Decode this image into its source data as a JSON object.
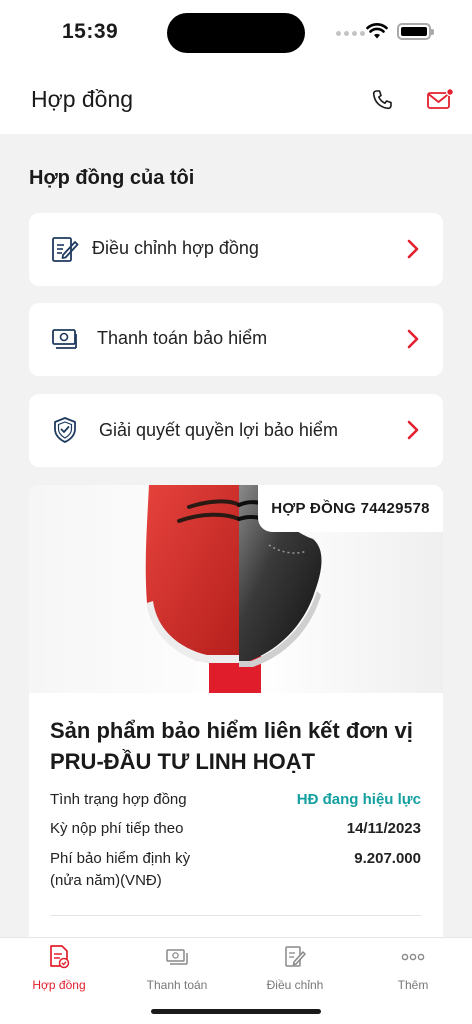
{
  "status_bar": {
    "time": "15:39"
  },
  "header": {
    "title": "Hợp đồng",
    "phone_icon": "phone-icon",
    "mail_icon": "mail-notification-icon"
  },
  "colors": {
    "accent": "#e4202e",
    "teal": "#14a0a0",
    "background": "#f2f2f2",
    "icon_navy": "#1f3a5f"
  },
  "section": {
    "title": "Hợp đồng của tôi"
  },
  "menu": [
    {
      "label": "Điều chỉnh hợp đồng",
      "icon": "contract-edit-icon"
    },
    {
      "label": "Thanh toán bảo hiểm",
      "icon": "payment-icon"
    },
    {
      "label": "Giải quyết quyền lợi bảo hiểm",
      "icon": "shield-check-icon"
    }
  ],
  "contract": {
    "badge": "HỢP ĐỒNG 74429578",
    "product_title": "Sản phẩm bảo hiểm liên kết đơn vị PRU-ĐẦU TƯ LINH HOẠT",
    "rows": [
      {
        "label": "Tình trạng hợp đồng",
        "value": "HĐ đang hiệu lực"
      },
      {
        "label": "Kỳ nộp phí tiếp theo",
        "value": "14/11/2023"
      },
      {
        "label": "Phí bảo hiểm định kỳ (nửa năm)(VNĐ)",
        "value": "9.207.000"
      }
    ]
  },
  "tabs": [
    {
      "label": "Hợp đồng",
      "icon": "contract-icon",
      "active": true
    },
    {
      "label": "Thanh toán",
      "icon": "payment-icon",
      "active": false
    },
    {
      "label": "Điều chỉnh",
      "icon": "edit-document-icon",
      "active": false
    },
    {
      "label": "Thêm",
      "icon": "more-icon",
      "active": false
    }
  ]
}
